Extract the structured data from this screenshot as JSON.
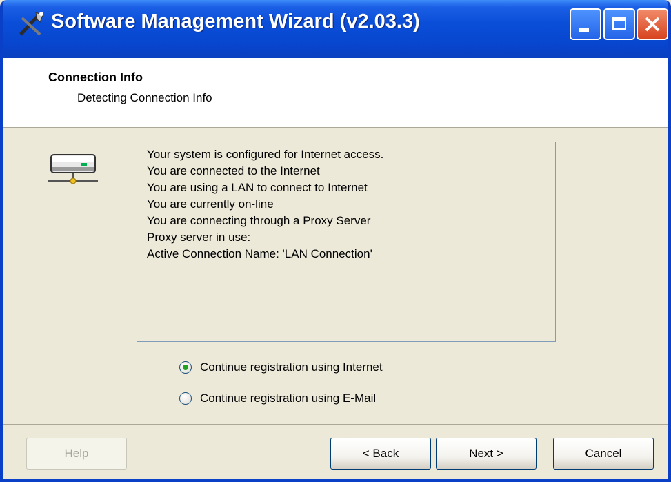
{
  "window": {
    "title": "Software Management Wizard (v2.03.3)"
  },
  "header": {
    "title": "Connection Info",
    "subtitle": "Detecting Connection Info"
  },
  "status_lines": [
    "Your system is configured for Internet access.",
    "You are connected to the Internet",
    "You are using a LAN to connect to Internet",
    "You are currently on-line",
    "You are connecting through a Proxy Server",
    "Proxy server in use:",
    "Active Connection Name: 'LAN Connection'"
  ],
  "options": {
    "internet": {
      "label": "Continue registration using Internet",
      "selected": true
    },
    "email": {
      "label": "Continue registration using E-Mail",
      "selected": false
    }
  },
  "buttons": {
    "help": "Help",
    "back": "< Back",
    "next": "Next >",
    "cancel": "Cancel"
  },
  "icons": {
    "app": "wizard-tools-icon",
    "connection": "network-lan-icon"
  }
}
